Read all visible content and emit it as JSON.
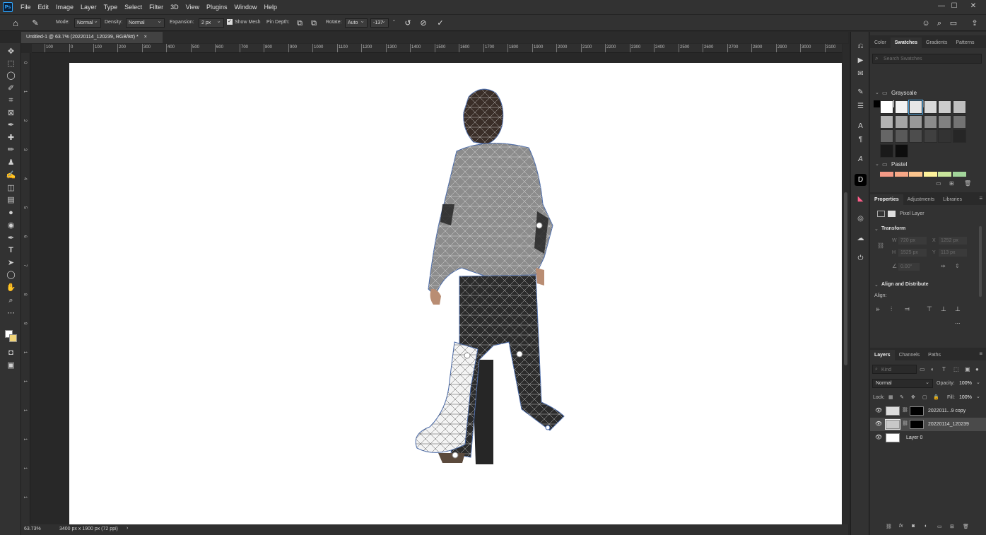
{
  "app": {
    "logo": "Ps"
  },
  "menu": [
    "File",
    "Edit",
    "Image",
    "Layer",
    "Type",
    "Select",
    "Filter",
    "3D",
    "View",
    "Plugins",
    "Window",
    "Help"
  ],
  "options": {
    "mode_label": "Mode:",
    "mode_value": "Normal",
    "density_label": "Density:",
    "density_value": "Normal",
    "expansion_label": "Expansion:",
    "expansion_value": "2 px",
    "show_mesh_label": "Show Mesh",
    "show_mesh_checked": true,
    "pin_depth_label": "Pin Depth:",
    "rotate_label": "Rotate:",
    "rotate_value": "Auto",
    "angle_value": "-137",
    "degree": "°"
  },
  "document": {
    "tab_title": "Untitled-1 @ 63.7% (20220114_120239, RGB/8#) *",
    "close": "×"
  },
  "ruler": {
    "h": [
      "100",
      "0",
      "100",
      "200",
      "300",
      "400",
      "500",
      "600",
      "700",
      "800",
      "900",
      "1000",
      "1100",
      "1200",
      "1300",
      "1400",
      "1500",
      "1600",
      "1700",
      "1800",
      "1900",
      "2000",
      "2100",
      "2200",
      "2300",
      "2400",
      "2500",
      "2600",
      "2700",
      "2800",
      "2900",
      "3000",
      "3100"
    ],
    "v": [
      "0",
      "1",
      "2",
      "3",
      "4",
      "5",
      "6",
      "7",
      "8",
      "9",
      "1",
      "1",
      "1",
      "1",
      "1",
      "1"
    ]
  },
  "status": {
    "zoom": "63.73%",
    "doc_info": "3400 px x 1900 px (72 ppi)",
    "arrow": "›"
  },
  "swatches_panel": {
    "tabs": [
      "Color",
      "Swatches",
      "Gradients",
      "Patterns"
    ],
    "active_tab": "Swatches",
    "search_placeholder": "Search Swatches",
    "recent": [
      "#000000",
      "#ffffff",
      "#f0f0f0",
      "#d8d8d8",
      "#bdbdbd",
      "#a2a2a2",
      "#ffffff",
      "#7a7a7a",
      "#5e5e5e"
    ],
    "group_grayscale": "Grayscale",
    "grayscale": [
      "#ffffff",
      "#f2f2f2",
      "#e6e6e6",
      "#d9d9d9",
      "#cccccc",
      "#bfbfbf",
      "#b3b3b3",
      "#a6a6a6",
      "#999999",
      "#8c8c8c",
      "#808080",
      "#737373",
      "#666666",
      "#595959",
      "#4d4d4d",
      "#404040",
      "#333333",
      "#262626",
      "#1a1a1a",
      "#0d0d0d"
    ],
    "group_pastel": "Pastel",
    "pastel": [
      "#f49a86",
      "#f7a786",
      "#fbc48d",
      "#fef29b",
      "#c9e59b",
      "#a2d59a"
    ]
  },
  "properties_panel": {
    "tabs": [
      "Properties",
      "Adjustments",
      "Libraries"
    ],
    "active_tab": "Properties",
    "layer_type": "Pixel Layer",
    "transform_title": "Transform",
    "w_label": "W",
    "w_value": "720 px",
    "h_label": "H",
    "h_value": "1525 px",
    "x_label": "X",
    "x_value": "1252 px",
    "y_label": "Y",
    "y_value": "113 px",
    "angle_value": "0.00°",
    "align_title": "Align and Distribute",
    "align_label": "Align:",
    "more": "..."
  },
  "layers_panel": {
    "tabs": [
      "Layers",
      "Channels",
      "Paths"
    ],
    "active_tab": "Layers",
    "kind_placeholder": "Kind",
    "blend_mode": "Normal",
    "opacity_label": "Opacity:",
    "opacity_value": "100%",
    "lock_label": "Lock:",
    "fill_label": "Fill:",
    "fill_value": "100%",
    "layers": [
      {
        "name": "2022011...9 copy",
        "selected": false
      },
      {
        "name": "20220114_120239",
        "selected": true
      },
      {
        "name": "Layer 0",
        "selected": false
      }
    ]
  }
}
